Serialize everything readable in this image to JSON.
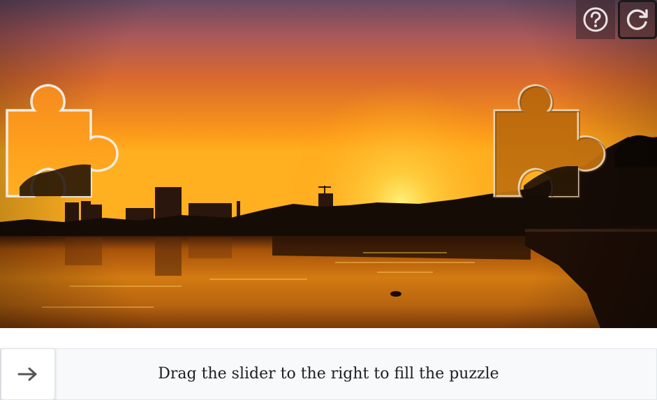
{
  "captcha": {
    "instruction": "Drag the slider to the right to fill the puzzle",
    "toolbar": {
      "help_icon": "question-circle-icon",
      "refresh_icon": "refresh-icon"
    },
    "slider": {
      "handle_icon": "arrow-right-icon",
      "progress": 0
    },
    "background": "sunset-over-lake",
    "colors": {
      "sky_top": "#6f4a5e",
      "sky_mid": "#e0722d",
      "horizon": "#ffb020",
      "silhouette": "#140c06",
      "water": "#c8680c",
      "track_bg": "#f7f9fa",
      "track_border": "#e4e7eb",
      "icon_gray": "#555555"
    }
  }
}
